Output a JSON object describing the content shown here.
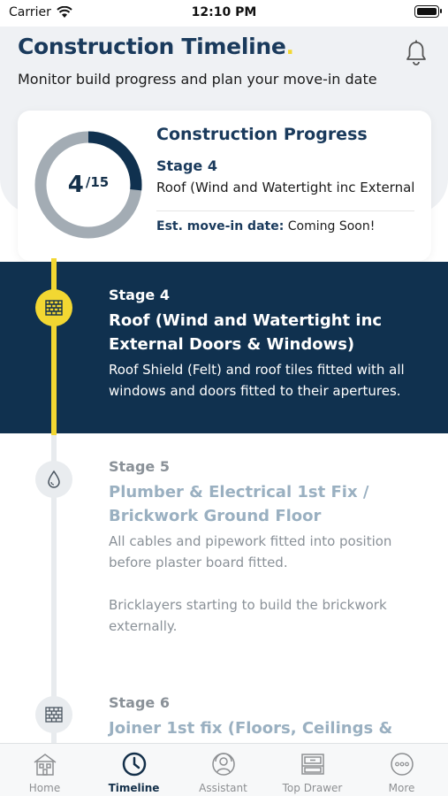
{
  "status_bar": {
    "carrier": "Carrier",
    "time": "12:10 PM"
  },
  "header": {
    "title": "Construction Timeline",
    "title_dot": ".",
    "subtitle": "Monitor build progress and plan your move-in date"
  },
  "progress_card": {
    "title": "Construction Progress",
    "current": "4",
    "total": "/15",
    "progress_fraction": 0.2667,
    "stage_label": "Stage 4",
    "stage_name": "Roof (Wind and Watertight inc External Doors & Windows)",
    "move_in_label": "Est. move-in date:",
    "move_in_value": "Coming Soon!"
  },
  "stages": [
    {
      "label": "Stage 4",
      "name": "Roof (Wind and Watertight inc External Doors & Windows)",
      "description": "Roof Shield (Felt) and roof tiles fitted with all windows and doors fitted to their apertures.",
      "icon": "roof-tiles-icon",
      "status": "active"
    },
    {
      "label": "Stage 5",
      "name": "Plumber & Electrical 1st Fix / Brickwork Ground Floor",
      "description": "All cables and pipework fitted into position before plaster board fitted.",
      "description_2": "Bricklayers starting to build the brickwork externally.",
      "icon": "water-drop-icon",
      "status": "upcoming"
    },
    {
      "label": "Stage 6",
      "name": "Joiner 1st fix (Floors, Ceilings &",
      "icon": "brick-wall-icon",
      "status": "upcoming"
    }
  ],
  "tab_bar": {
    "tabs": [
      {
        "label": "Home",
        "icon": "house-icon"
      },
      {
        "label": "Timeline",
        "icon": "clock-icon"
      },
      {
        "label": "Assistant",
        "icon": "assistant-icon"
      },
      {
        "label": "Top Drawer",
        "icon": "drawer-icon"
      },
      {
        "label": "More",
        "icon": "more-icon"
      }
    ],
    "active": "Timeline"
  },
  "colors": {
    "navy": "#10314f",
    "accent_yellow": "#f2d732",
    "muted_text": "#8a9198",
    "muted_title": "#9ab0c1",
    "ring_track": "#a3acb4"
  }
}
